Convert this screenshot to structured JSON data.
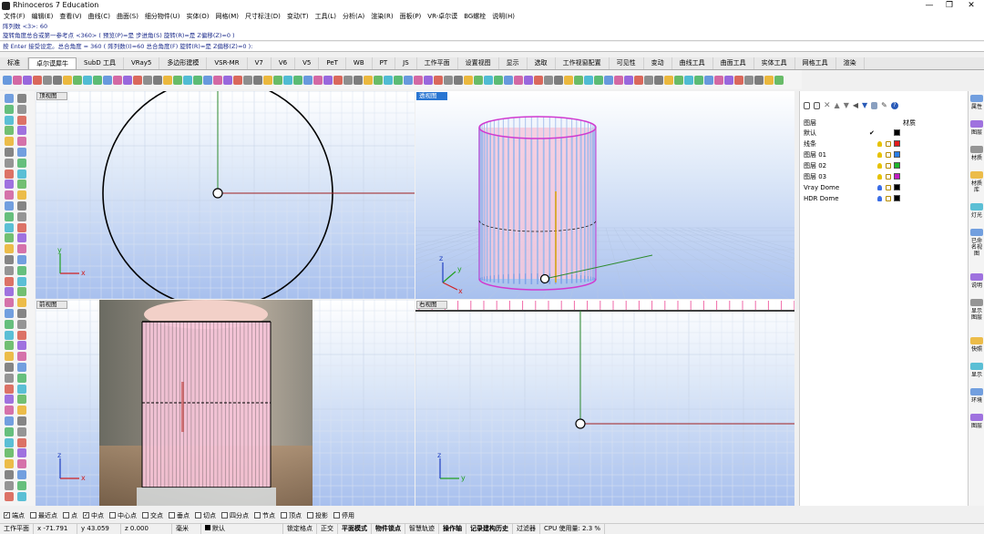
{
  "window": {
    "title": "Rhinoceros 7 Education",
    "min": "—",
    "max": "❐",
    "close": "✕"
  },
  "menu": [
    "文件(F)",
    "编辑(E)",
    "查看(V)",
    "曲线(C)",
    "曲面(S)",
    "细分物件(U)",
    "实体(O)",
    "网格(M)",
    "尺寸标注(D)",
    "变动(T)",
    "工具(L)",
    "分析(A)",
    "渲染(R)",
    "面板(P)",
    "VR-卓尔谟",
    "BG螺栓",
    "说明(H)"
  ],
  "command": {
    "history1": "阵列数 <3>: 60",
    "history2": "旋转角度总合或第一参考点 <360> ( 预览(P)=是 步进角(S) 旋转(R)=是 Z偏移(Z)=0 )",
    "prompt": "按 Enter 接受设定。总合角度 = 360 ( 阵列数(I)=60 总合角度(F) 旋转(R)=是 Z偏移(Z)=0 ):"
  },
  "tabs": [
    "标准",
    "卓尔谟犀牛",
    "SubD 工具",
    "VRay5",
    "多边形建模",
    "VSR-MR",
    "V7",
    "V6",
    "V5",
    "PeT",
    "WB",
    "PT",
    "JS",
    "工作平面",
    "设置视图",
    "显示",
    "选取",
    "工作视窗配置",
    "可见性",
    "变动",
    "曲线工具",
    "曲面工具",
    "实体工具",
    "网格工具",
    "渲染"
  ],
  "viewports": {
    "top": {
      "label": "顶视图",
      "axis_x": "x",
      "axis_y": "y"
    },
    "perspective": {
      "label": "透视图",
      "axis_x": "x",
      "axis_y": "y",
      "axis_z": "z"
    },
    "front": {
      "label": "前视图",
      "axis_x": "x",
      "axis_z": "z"
    },
    "right": {
      "label": "右视图",
      "axis_y": "y",
      "axis_z": "z"
    }
  },
  "layers": {
    "header_name": "图层",
    "header_material": "材质",
    "rows": [
      {
        "name": "默认",
        "current": "✔",
        "color": "#000000",
        "bulb": ""
      },
      {
        "name": "线条",
        "current": "",
        "color": "#e21b1b",
        "bulb": "#e6c200"
      },
      {
        "name": "图层 01",
        "current": "",
        "color": "#2a7ee6",
        "bulb": "#e6c200"
      },
      {
        "name": "图层 02",
        "current": "",
        "color": "#1fb82b",
        "bulb": "#e6c200"
      },
      {
        "name": "图层 03",
        "current": "",
        "color": "#c21bc2",
        "bulb": "#e6c200"
      },
      {
        "name": "Vray Dome",
        "current": "",
        "color": "#000000",
        "bulb": "#3a6de6"
      },
      {
        "name": "HDR Dome",
        "current": "",
        "color": "#000000",
        "bulb": "#3a6de6"
      }
    ]
  },
  "side_tabs": [
    "属性",
    "图层",
    "材质",
    "材质库",
    "灯光",
    "已命名视图",
    "说明",
    "显示图层",
    "快照",
    "显示",
    "环境",
    "图层"
  ],
  "osnap": [
    {
      "label": "端点",
      "on": true
    },
    {
      "label": "最近点",
      "on": false
    },
    {
      "label": "点",
      "on": false
    },
    {
      "label": "中点",
      "on": true
    },
    {
      "label": "中心点",
      "on": false
    },
    {
      "label": "交点",
      "on": false
    },
    {
      "label": "垂点",
      "on": false
    },
    {
      "label": "切点",
      "on": false
    },
    {
      "label": "四分点",
      "on": false
    },
    {
      "label": "节点",
      "on": false
    },
    {
      "label": "顶点",
      "on": false
    },
    {
      "label": "投影",
      "on": false
    },
    {
      "label": "停用",
      "on": false
    }
  ],
  "status": {
    "cplane": "工作平面",
    "x": "x -71.791",
    "y": "y 43.059",
    "z": "z 0.000",
    "unit": "毫米",
    "layer": "默认",
    "lock": "锁定格点",
    "ortho": "正交",
    "planar": "平面模式",
    "osnap": "物件锁点",
    "smarttrack": "智慧轨迹",
    "gumball": "操作轴",
    "history": "记录建构历史",
    "filter": "过滤器",
    "cpu": "CPU 使用量: 2.3 %"
  }
}
